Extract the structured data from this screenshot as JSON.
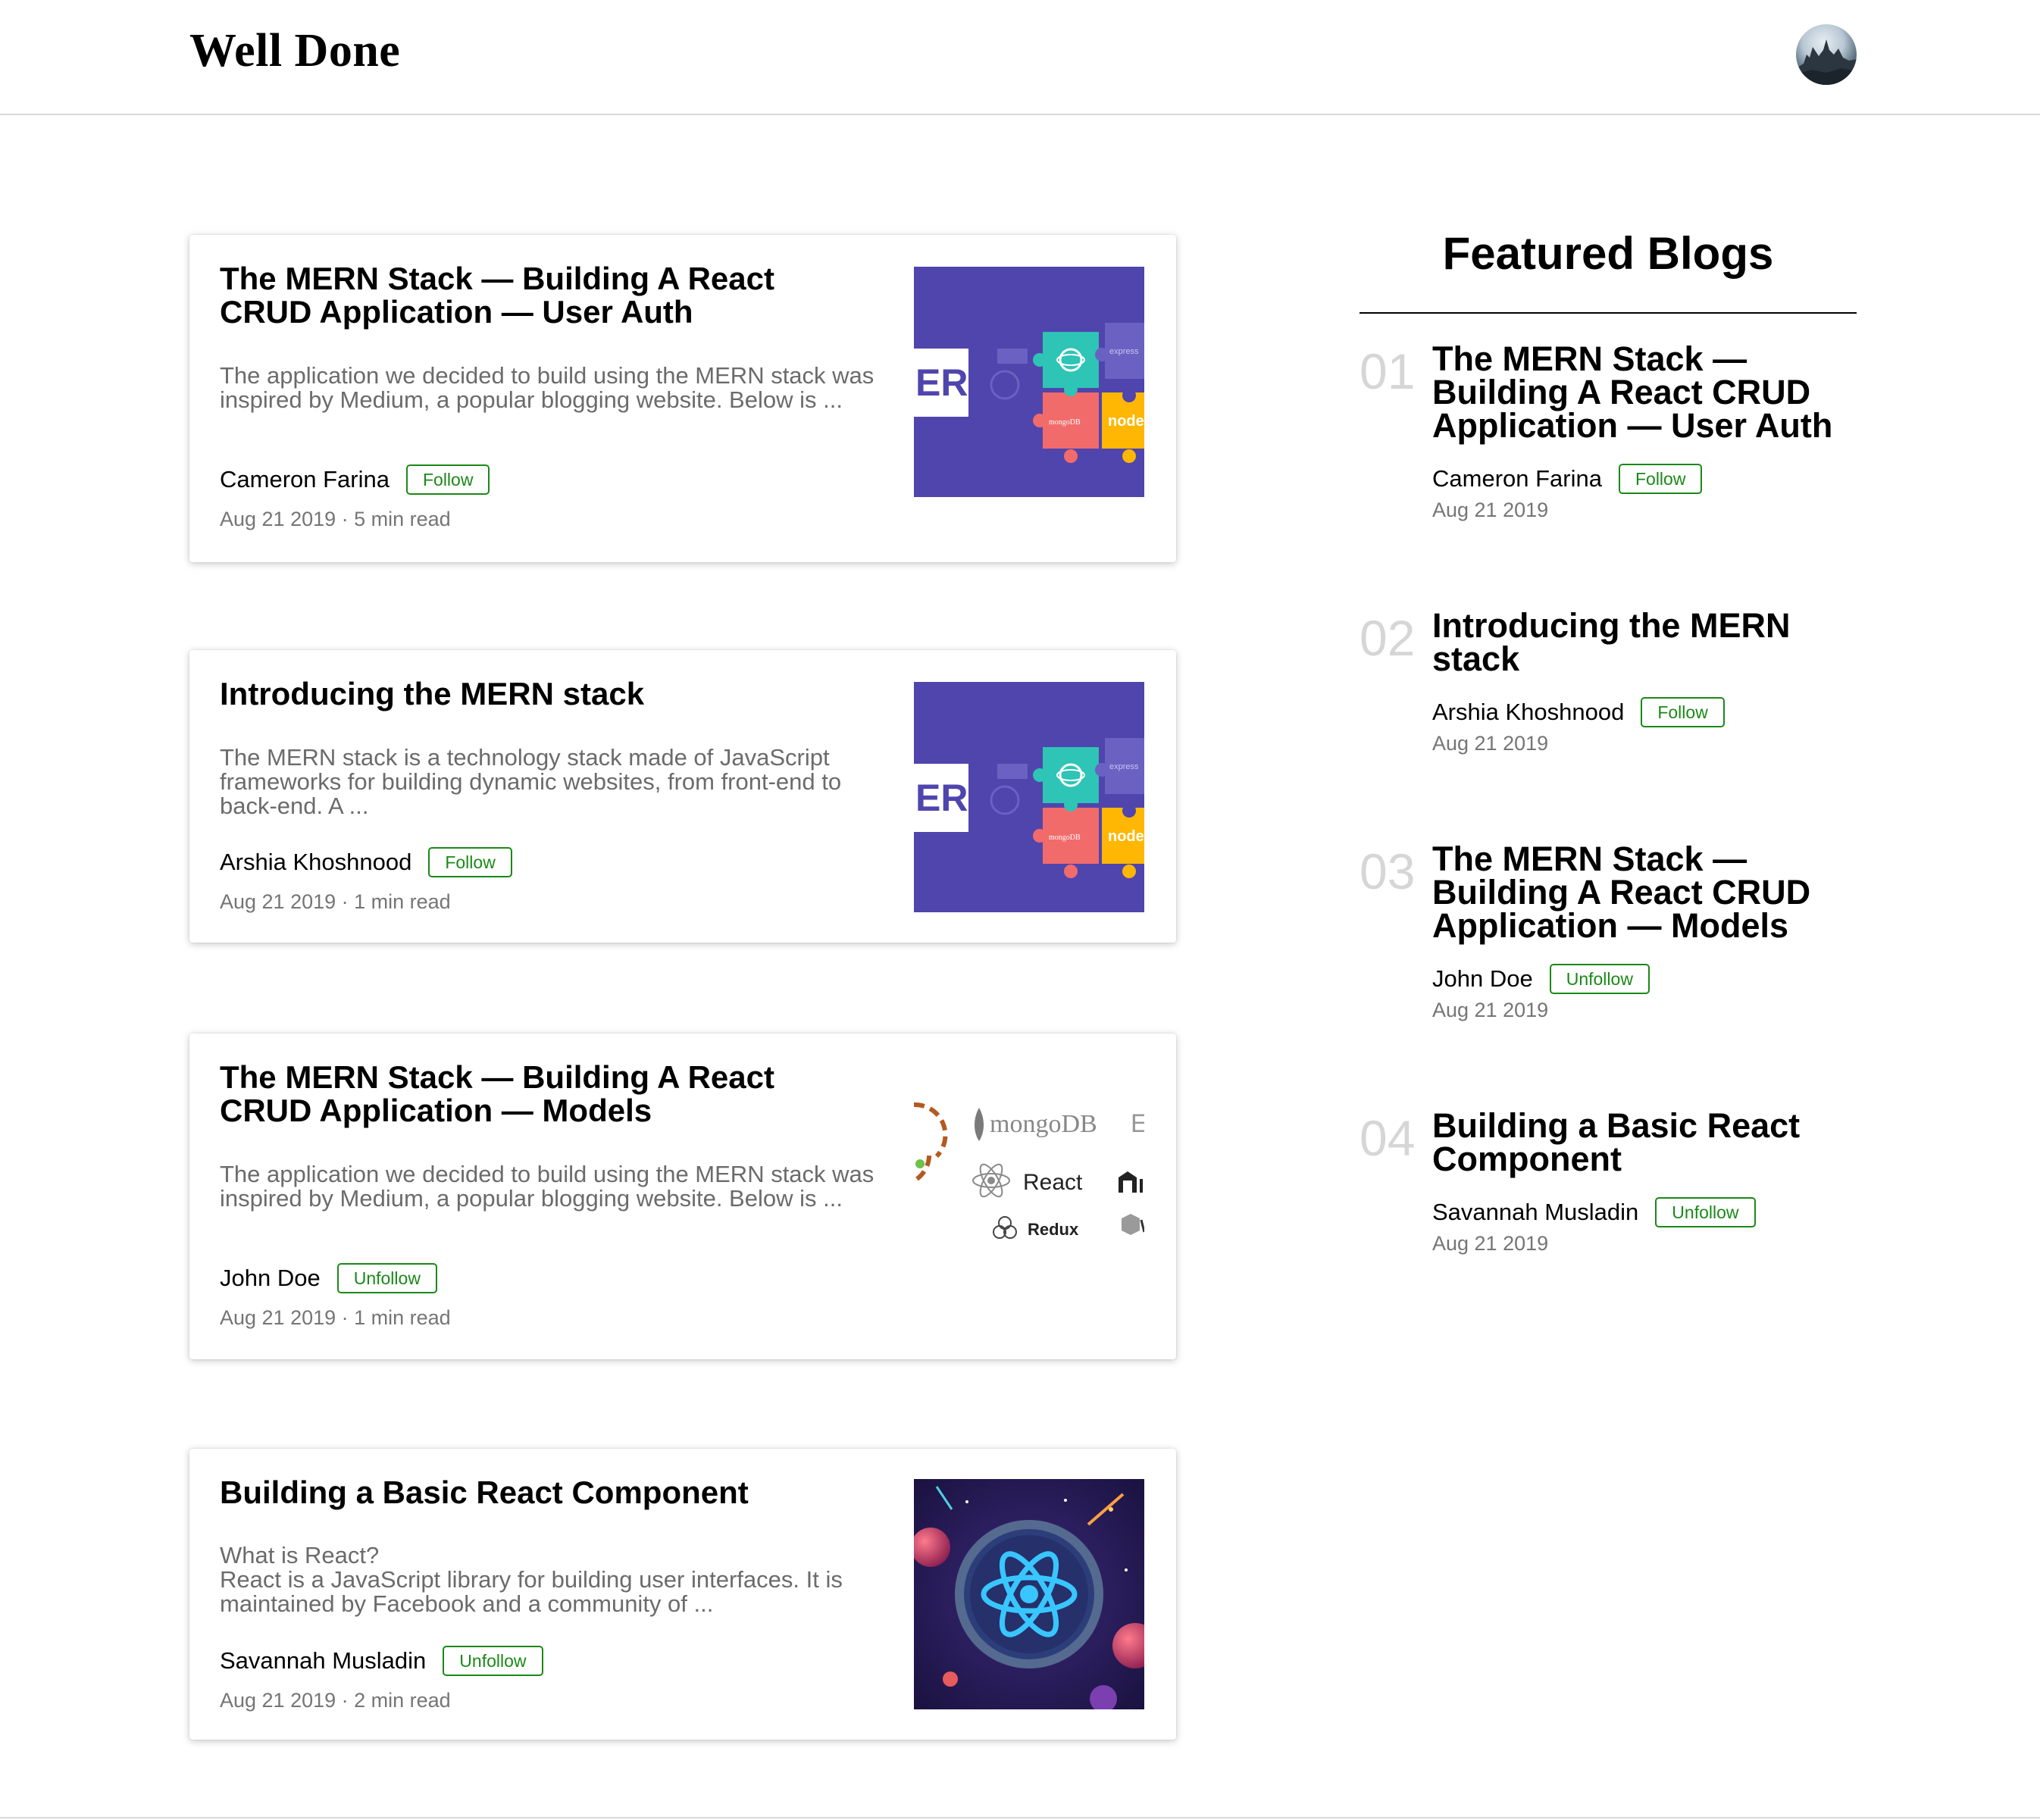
{
  "header": {
    "brand": "Well Done",
    "avatar_icon": "profile-photo-avatar"
  },
  "feed": {
    "posts": [
      {
        "title": "The MERN Stack — Building A React CRUD Application — User Auth",
        "excerpt": "The application we decided to build using the MERN stack was inspired by Medium, a popular blogging website. Below is ...",
        "author": "Cameron Farina",
        "follow_label": "Follow",
        "date": "Aug 21 2019",
        "read_time": "5 min read",
        "meta": "Aug 21 2019 · 5 min read",
        "thumbnail": "mern-puzzle-illustration",
        "thumb_text": {
          "mern": "ERN",
          "mongo": "mongoDB",
          "node": "node",
          "express": "express"
        }
      },
      {
        "title": "Introducing the MERN stack",
        "excerpt": "The MERN stack is a technology stack made of JavaScript frameworks for building dynamic websites, from front-end to back-end. A ...",
        "author": "Arshia Khoshnood",
        "follow_label": "Follow",
        "date": "Aug 21 2019",
        "read_time": "1 min read",
        "meta": "Aug 21 2019 · 1 min read",
        "thumbnail": "mern-puzzle-illustration",
        "thumb_text": {
          "mern": "ERN",
          "mongo": "mongoDB",
          "node": "node",
          "express": "express"
        }
      },
      {
        "title": "The MERN Stack — Building A React CRUD Application — Models",
        "excerpt": "The application we decided to build using the MERN stack was inspired by Medium, a popular blogging website. Below is ...",
        "author": "John Doe",
        "follow_label": "Unfollow",
        "date": "Aug 21 2019",
        "read_time": "1 min read",
        "meta": "Aug 21 2019 · 1 min read",
        "thumbnail": "tech-logos-mongodb-react-redux",
        "thumb_text": {
          "mongo": "mongoDB",
          "react": "React",
          "redux": "Redux"
        }
      },
      {
        "title": "Building a Basic React Component",
        "excerpt": "What is React?\nReact is a JavaScript library for building user interfaces. It is maintained by Facebook and a community of ...",
        "author": "Savannah Musladin",
        "follow_label": "Unfollow",
        "date": "Aug 21 2019",
        "read_time": "2 min read",
        "meta": "Aug 21 2019 · 2 min read",
        "thumbnail": "react-atom-space-illustration"
      }
    ]
  },
  "sidebar": {
    "title": "Featured Blogs",
    "items": [
      {
        "number": "01",
        "title": "The MERN Stack — Building A React CRUD Application — User Auth",
        "author": "Cameron Farina",
        "follow_label": "Follow",
        "date": "Aug 21 2019"
      },
      {
        "number": "02",
        "title": "Introducing the MERN stack",
        "author": "Arshia Khoshnood",
        "follow_label": "Follow",
        "date": "Aug 21 2019"
      },
      {
        "number": "03",
        "title": "The MERN Stack — Building A React CRUD Application — Models",
        "author": "John Doe",
        "follow_label": "Unfollow",
        "date": "Aug 21 2019"
      },
      {
        "number": "04",
        "title": "Building a Basic React Component",
        "author": "Savannah Musladin",
        "follow_label": "Unfollow",
        "date": "Aug 21 2019"
      }
    ]
  },
  "colors": {
    "follow_green": "#1a8917",
    "mern_purple": "#4f45ad",
    "muted_text": "#6b6b6b",
    "number_gray": "#d6d6d6"
  }
}
